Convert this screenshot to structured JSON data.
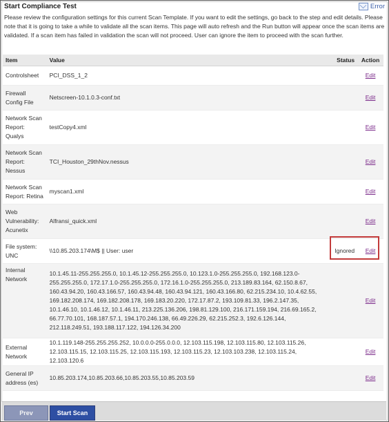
{
  "header": {
    "title": "Start Compliance Test",
    "error_label": "Error",
    "intro": "Please review the configuration settings for this current Scan Template. If you want to edit the settings, go back to the step and edit details. Please note that it is going to take a while to validate all the scan items. This page will auto refresh and the Run button will appear once the scan items are validated. If a scan item has failed in validation the scan will not proceed. User can ignore the item to proceed with the scan further."
  },
  "table": {
    "columns": {
      "item": "Item",
      "value": "Value",
      "status": "Status",
      "action": "Action"
    },
    "rows": [
      {
        "item": "Controlsheet",
        "value": "PCI_DSS_1_2",
        "status": "",
        "action": "Edit"
      },
      {
        "item": "Firewall Config File",
        "value": "Netscreen-10.1.0.3-conf.txt",
        "status": "",
        "action": "Edit"
      },
      {
        "item": "Network Scan Report: Qualys",
        "value": "testCopy4.xml",
        "status": "",
        "action": "Edit"
      },
      {
        "item": "Network Scan Report: Nessus",
        "value": "TCI_Houston_29thNov.nessus",
        "status": "",
        "action": "Edit"
      },
      {
        "item": "Network Scan Report: Retina",
        "value": "myscan1.xml",
        "status": "",
        "action": "Edit"
      },
      {
        "item": "Web Vulnerability: Acunetix",
        "value": "Alfransi_quick.xml",
        "status": "",
        "action": "Edit"
      },
      {
        "item": "File system: UNC",
        "value": "\\\\10.85.203.174\\M$  ||  User: user",
        "status": "Ignored",
        "action": "Edit"
      },
      {
        "item": "Internal Network",
        "value": "10.1.45.11-255.255.255.0, 10.1.45.12-255.255.255.0, 10.123.1.0-255.255.255.0, 192.168.123.0-255.255.255.0, 172.17.1.0-255.255.255.0, 172.16.1.0-255.255.255.0, 213.189.83.164, 62.150.8.67, 160.43.94.20, 160.43.166.57, 160.43.94.48, 160.43.94.121, 160.43.166.80, 62.215.234.10, 10.4.62.55, 169.182.208.174, 169.182.208.178, 169.183.20.220, 172.17.87.2, 193.109.81.33, 196.2.147.35, 10.1.46.10, 10.1.46.12, 10.1.46.11, 213.225.136.206, 198.81.129.100, 216.171.159.194, 216.69.165.2, 66.77.70.101, 168.187.57.1, 194.170.246.138, 66.49.226.29, 62.215.252.3, 192.6.126.144, 212.118.249.51, 193.188.117.122, 194.126.34.200",
        "status": "",
        "action": "Edit"
      },
      {
        "item": "External Network",
        "value": "10.1.119.148-255.255.255.252, 10.0.0.0-255.0.0.0, 12.103.115.198, 12.103.115.80, 12.103.115.26, 12.103.115.15, 12.103.115.25, 12.103.115.193, 12.103.115.23, 12.103.103.238, 12.103.115.24, 12.103.120.6",
        "status": "",
        "action": "Edit"
      },
      {
        "item": "General IP address (es)",
        "value": "10.85.203.174,10.85.203.66,10.85.203.55,10.85.203.59",
        "status": "",
        "action": "Edit"
      }
    ]
  },
  "footer": {
    "prev_label": "Prev",
    "start_label": "Start Scan"
  },
  "colors": {
    "accent": "#2e4fa3",
    "highlight": "#c23a3a",
    "link": "#7b2a8a"
  }
}
